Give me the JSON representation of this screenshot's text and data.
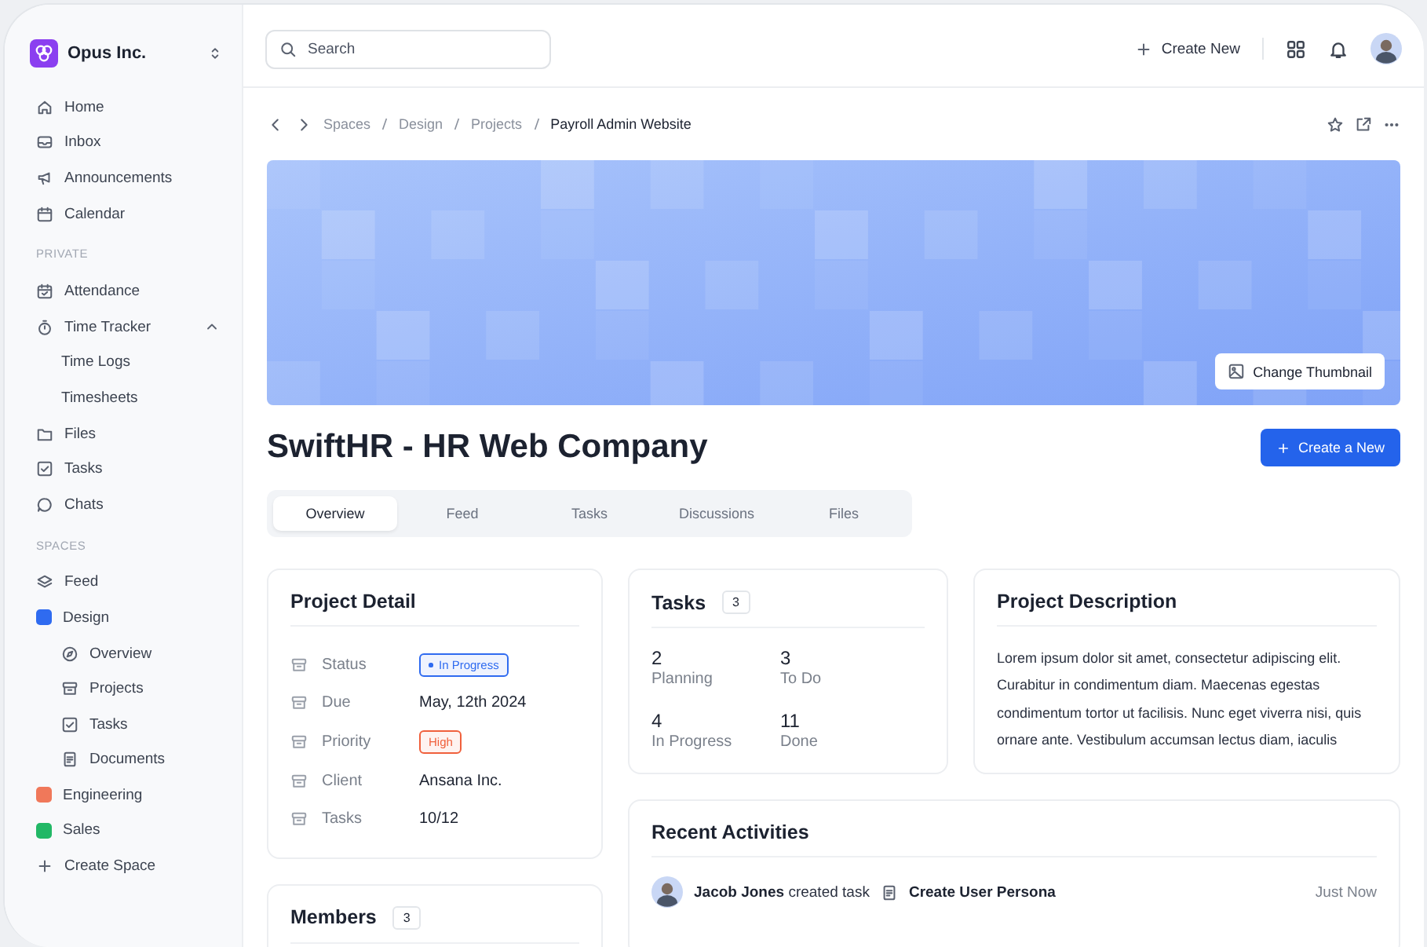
{
  "sidebar": {
    "workspace": "Opus Inc.",
    "groups": [
      {
        "items": [
          {
            "label": "Home"
          },
          {
            "label": "Inbox"
          },
          {
            "label": "Announcements"
          },
          {
            "label": "Calendar"
          }
        ]
      },
      {
        "label": "PRIVATE",
        "items": [
          {
            "label": "Attendance"
          },
          {
            "label": "Time Tracker",
            "expanded": true,
            "children": [
              {
                "label": "Time Logs"
              },
              {
                "label": "Timesheets"
              }
            ]
          },
          {
            "label": "Files"
          },
          {
            "label": "Tasks"
          },
          {
            "label": "Chats"
          }
        ]
      },
      {
        "label": "SPACES",
        "items": [
          {
            "label": "Feed"
          },
          {
            "label": "Design",
            "kind": "space",
            "color": "#2f6bf0",
            "children": [
              {
                "label": "Overview"
              },
              {
                "label": "Projects"
              },
              {
                "label": "Tasks"
              },
              {
                "label": "Documents"
              }
            ]
          },
          {
            "label": "Engineering",
            "kind": "space",
            "color": "#f0785a"
          },
          {
            "label": "Sales",
            "kind": "space",
            "color": "#22b866"
          },
          {
            "label": "Create Space",
            "kind": "action"
          }
        ]
      }
    ]
  },
  "topbar": {
    "search": {
      "placeholder": "Search"
    },
    "create_button": "Create New"
  },
  "breadcrumb": [
    {
      "label": "Spaces",
      "current": false
    },
    {
      "label": "Design",
      "current": false
    },
    {
      "label": "Projects",
      "current": false
    },
    {
      "label": "Payroll Admin Website",
      "current": true
    }
  ],
  "banner": {
    "kind": "picture",
    "button": "Change Thumbnail"
  },
  "title": "SwiftHR - HR Web Company",
  "primary_button": "Create a New",
  "tabs": [
    {
      "label": "Overview",
      "selected": true
    },
    {
      "label": "Feed",
      "selected": false
    },
    {
      "label": "Tasks",
      "selected": false
    },
    {
      "label": "Discussions",
      "selected": false
    },
    {
      "label": "Files",
      "selected": false
    }
  ],
  "project_detail": {
    "title": "Project Detail",
    "rows": [
      {
        "label": "Status",
        "value": "In Progress",
        "kind": "badge",
        "color": "#2f6bf0"
      },
      {
        "label": "Due",
        "value": "May, 12th 2024",
        "kind": "text"
      },
      {
        "label": "Priority",
        "value": "High",
        "kind": "badge",
        "color": "#f0603c"
      },
      {
        "label": "Client",
        "value": "Ansana Inc.",
        "kind": "text"
      },
      {
        "label": "Tasks",
        "value": "10/12",
        "kind": "text"
      }
    ]
  },
  "tasks": {
    "title": "Tasks",
    "count": "3",
    "stats": [
      {
        "value": "2",
        "label": "Planning"
      },
      {
        "value": "3",
        "label": "To Do"
      },
      {
        "value": "4",
        "label": "In Progress"
      },
      {
        "value": "11",
        "label": "Done"
      }
    ]
  },
  "project_description": {
    "title": "Project Description",
    "text": "Lorem ipsum dolor sit amet, consectetur adipiscing elit. Curabitur in condimentum diam. Maecenas egestas condimentum tortor ut facilisis. Nunc eget viverra nisi, quis ornare ante. Vestibulum accumsan lectus diam, iaculis"
  },
  "members": {
    "title": "Members",
    "count": "3"
  },
  "recent_activities": {
    "title": "Recent Activities",
    "items": [
      {
        "text": "**Jacob Jones** created task",
        "target": "Create User Persona",
        "time": "Just Now"
      }
    ]
  }
}
